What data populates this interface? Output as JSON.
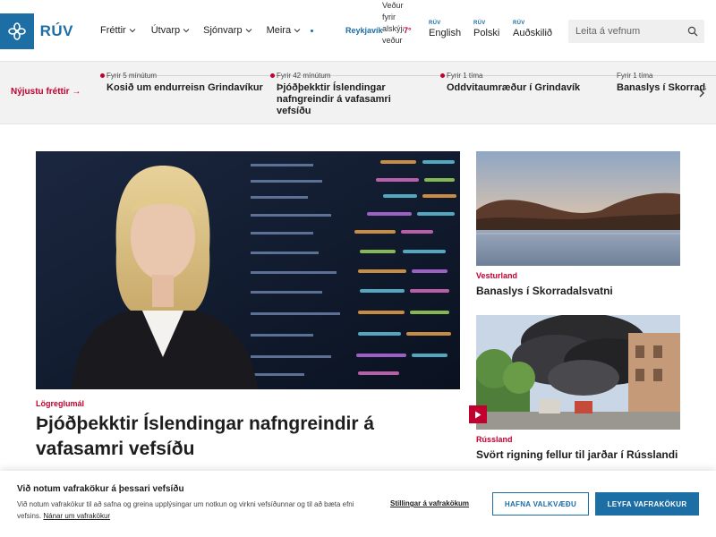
{
  "header": {
    "logo_text": "RÚV",
    "nav": [
      {
        "label": "Fréttir"
      },
      {
        "label": "Útvarp"
      },
      {
        "label": "Sjónvarp"
      },
      {
        "label": "Meira"
      }
    ],
    "weather": {
      "city": "Reykjavík",
      "img_alt": "Veðurspá fyrir alskýjað veður",
      "temp": "7°"
    },
    "languages": [
      {
        "tag": "RÚV",
        "name": "English"
      },
      {
        "tag": "RÚV",
        "name": "Polski"
      },
      {
        "tag": "RÚV",
        "name": "Auðskilið"
      }
    ],
    "search": {
      "placeholder": "Leita á vefnum"
    }
  },
  "ticker": {
    "label": "Nýjustu fréttir →",
    "items": [
      {
        "time": "Fyrir 5 mínútum",
        "title": "Kosið um endurreisn Grindavíkur"
      },
      {
        "time": "Fyrir 42 mínútum",
        "title": "Þjóðþekktir Íslendingar nafngreindir á vafasamri vefsíðu"
      },
      {
        "time": "Fyrir 1 tíma",
        "title": "Oddvitaumræður í Grindavík"
      },
      {
        "time": "Fyrir 1 tíma",
        "title": "Banaslys í Skorradalsvatni"
      }
    ]
  },
  "main_story": {
    "category": "Lögreglumál",
    "title": "Þjóðþekktir Íslendingar nafngreindir á vafasamri vefsíðu"
  },
  "side_stories": [
    {
      "category": "Vesturland",
      "title": "Banaslys í Skorradalsvatni"
    },
    {
      "category": "Rússland",
      "title": "Svört rigning fellur til jarðar í Rússlandi"
    }
  ],
  "cookie_banner": {
    "title": "Við notum vafrakökur á þessari vefsíðu",
    "text": "Við notum vafrakökur til að safna og greina upplýsingar um notkun og virkni vefsíðunnar og til að bæta efni vefsins.",
    "more_link": "Nánar um vafrakökur",
    "settings_link": "Stillingar á vafrakökum",
    "reject_label": "HAFNA VALKVÆÐU",
    "accept_label": "LEYFA VAFRAKÖKUR"
  },
  "colors": {
    "brand_blue": "#1c6ea4",
    "accent_red": "#c2002f"
  }
}
